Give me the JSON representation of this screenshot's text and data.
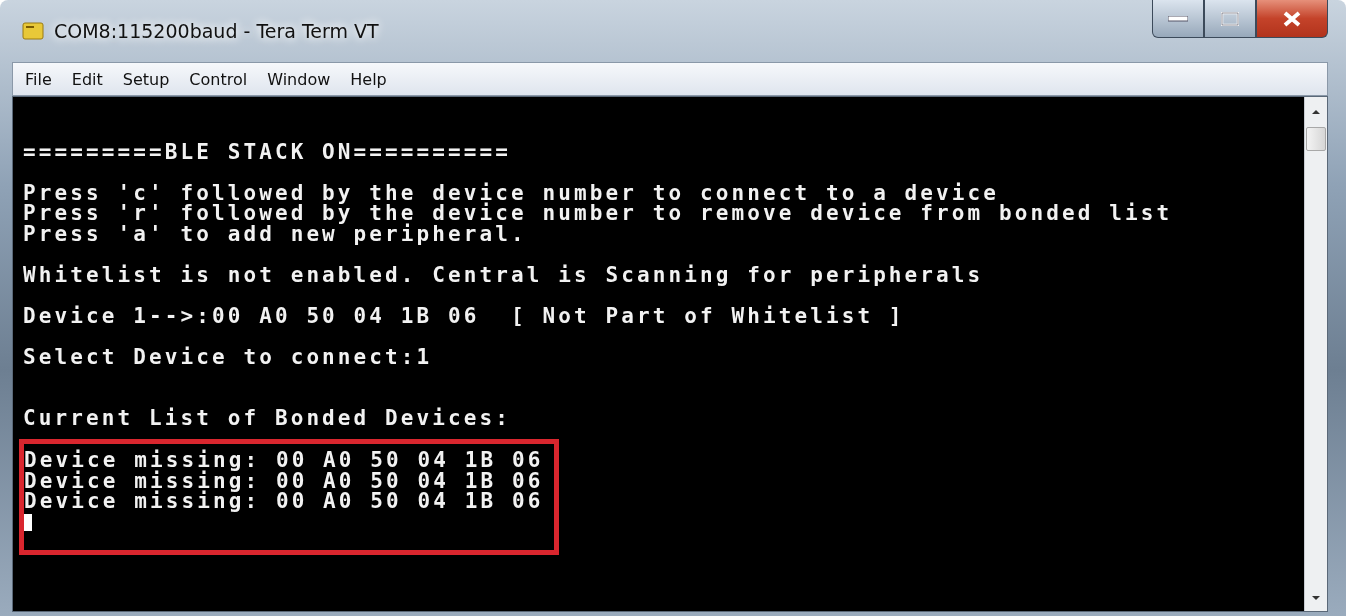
{
  "window": {
    "title": "COM8:115200baud - Tera Term VT"
  },
  "menu": [
    "File",
    "Edit",
    "Setup",
    "Control",
    "Window",
    "Help"
  ],
  "terminal": {
    "lines": [
      {
        "kind": "blank"
      },
      {
        "kind": "text",
        "text": "=========BLE STACK ON=========="
      },
      {
        "kind": "blank"
      },
      {
        "kind": "text",
        "text": "Press 'c' followed by the device number to connect to a device"
      },
      {
        "kind": "text",
        "text": "Press 'r' followed by the device number to remove device from bonded list"
      },
      {
        "kind": "text",
        "text": "Press 'a' to add new peripheral."
      },
      {
        "kind": "blank"
      },
      {
        "kind": "text",
        "text": "Whitelist is not enabled. Central is Scanning for peripherals"
      },
      {
        "kind": "blank"
      },
      {
        "kind": "text",
        "text": "Device 1-->:00 A0 50 04 1B 06  [ Not Part of Whitelist ]"
      },
      {
        "kind": "blank"
      },
      {
        "kind": "text",
        "text": "Select Device to connect:1"
      },
      {
        "kind": "blank"
      },
      {
        "kind": "blank"
      },
      {
        "kind": "text",
        "text": "Current List of Bonded Devices:"
      },
      {
        "kind": "blank"
      }
    ],
    "highlighted_lines": [
      "Device missing: 00 A0 50 04 1B 06",
      "Device missing: 00 A0 50 04 1B 06",
      "Device missing: 00 A0 50 04 1B 06"
    ]
  }
}
